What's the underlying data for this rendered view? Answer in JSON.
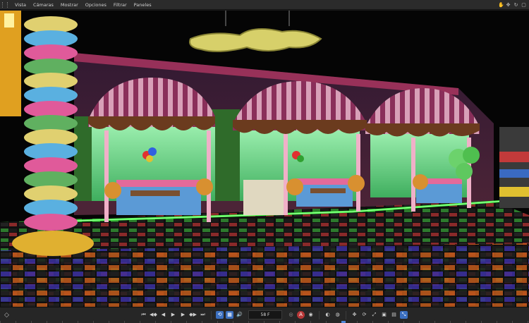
{
  "menu": {
    "items": [
      "Vista",
      "Cámaras",
      "Mostrar",
      "Opciones",
      "Filtrar",
      "Paneles"
    ]
  },
  "timeline": {
    "frame": "58 F"
  },
  "colors": {
    "accent": "#3b6fbf",
    "record": "#b73737",
    "neon_green": "#3cff3c"
  }
}
